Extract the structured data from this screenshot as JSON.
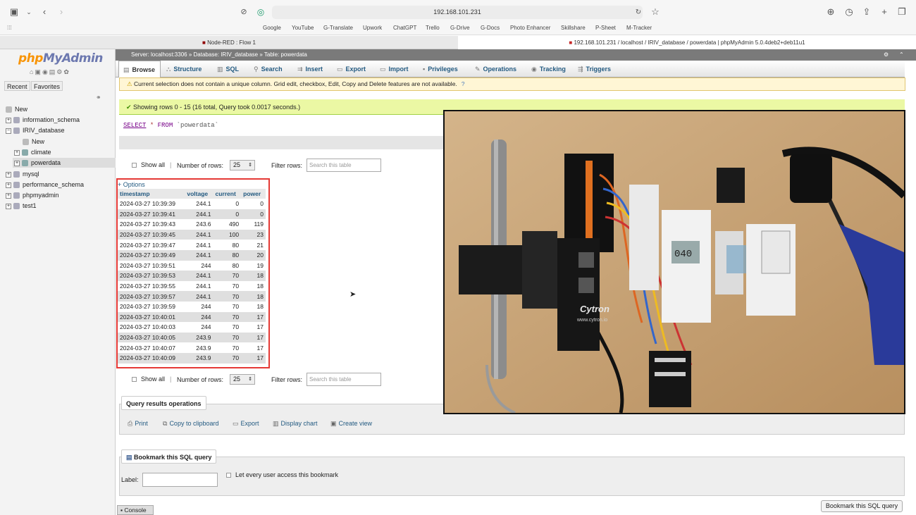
{
  "browser": {
    "url": "192.168.101.231",
    "bookmarks": [
      "Google",
      "YouTube",
      "G-Translate",
      "Upwork",
      "ChatGPT",
      "Trello",
      "G-Drive",
      "G-Docs",
      "Photo Enhancer",
      "Skillshare",
      "P-Sheet",
      "M-Tracker"
    ],
    "tabs": [
      {
        "label": "Node-RED : Flow 1",
        "active": false
      },
      {
        "label": "192.168.101.231 / localhost / IRIV_database / powerdata | phpMyAdmin 5.0.4deb2+deb11u1",
        "active": true
      }
    ]
  },
  "sidebar": {
    "logo_php": "php",
    "logo_rest": "MyAdmin",
    "tab_recent": "Recent",
    "tab_favorites": "Favorites",
    "tree": [
      {
        "label": "New",
        "indent": 0,
        "type": "new"
      },
      {
        "label": "information_schema",
        "indent": 0,
        "type": "db"
      },
      {
        "label": "IRIV_database",
        "indent": 0,
        "type": "db"
      },
      {
        "label": "New",
        "indent": 1,
        "type": "new"
      },
      {
        "label": "climate",
        "indent": 1,
        "type": "table"
      },
      {
        "label": "powerdata",
        "indent": 1,
        "type": "table",
        "selected": true
      },
      {
        "label": "mysql",
        "indent": 0,
        "type": "db"
      },
      {
        "label": "performance_schema",
        "indent": 0,
        "type": "db"
      },
      {
        "label": "phpmyadmin",
        "indent": 0,
        "type": "db"
      },
      {
        "label": "test1",
        "indent": 0,
        "type": "db"
      }
    ]
  },
  "breadcrumb": {
    "server": "Server: localhost:3306",
    "database": "Database: IRIV_database",
    "table": "Table: powerdata"
  },
  "menu": [
    {
      "label": "Browse",
      "icon": "▤",
      "active": true
    },
    {
      "label": "Structure",
      "icon": "⛬"
    },
    {
      "label": "SQL",
      "icon": "▥"
    },
    {
      "label": "Search",
      "icon": "⚲"
    },
    {
      "label": "Insert",
      "icon": "⇉"
    },
    {
      "label": "Export",
      "icon": "▭"
    },
    {
      "label": "Import",
      "icon": "▭"
    },
    {
      "label": "Privileges",
      "icon": "▪"
    },
    {
      "label": "Operations",
      "icon": "✎"
    },
    {
      "label": "Tracking",
      "icon": "◉"
    },
    {
      "label": "Triggers",
      "icon": "⇶"
    }
  ],
  "warning": "Current selection does not contain a unique column. Grid edit, checkbox, Edit, Copy and Delete features are not available.",
  "success": "Showing rows 0 - 15 (16 total, Query took 0.0017 seconds.)",
  "sql": {
    "select": "SELECT",
    "star": "*",
    "from": "FROM",
    "table": "`powerdata`"
  },
  "controls": {
    "show_all": "Show all",
    "num_rows_label": "Number of rows:",
    "num_rows_value": "25",
    "filter_label": "Filter rows:",
    "filter_placeholder": "Search this table"
  },
  "options_link": "+ Options",
  "table": {
    "columns": [
      "timestamp",
      "voltage",
      "current",
      "power"
    ],
    "rows": [
      [
        "2024-03-27 10:39:39",
        "244.1",
        "0",
        "0"
      ],
      [
        "2024-03-27 10:39:41",
        "244.1",
        "0",
        "0"
      ],
      [
        "2024-03-27 10:39:43",
        "243.6",
        "490",
        "119"
      ],
      [
        "2024-03-27 10:39:45",
        "244.1",
        "100",
        "23"
      ],
      [
        "2024-03-27 10:39:47",
        "244.1",
        "80",
        "21"
      ],
      [
        "2024-03-27 10:39:49",
        "244.1",
        "80",
        "20"
      ],
      [
        "2024-03-27 10:39:51",
        "244",
        "80",
        "19"
      ],
      [
        "2024-03-27 10:39:53",
        "244.1",
        "70",
        "18"
      ],
      [
        "2024-03-27 10:39:55",
        "244.1",
        "70",
        "18"
      ],
      [
        "2024-03-27 10:39:57",
        "244.1",
        "70",
        "18"
      ],
      [
        "2024-03-27 10:39:59",
        "244",
        "70",
        "18"
      ],
      [
        "2024-03-27 10:40:01",
        "244",
        "70",
        "17"
      ],
      [
        "2024-03-27 10:40:03",
        "244",
        "70",
        "17"
      ],
      [
        "2024-03-27 10:40:05",
        "243.9",
        "70",
        "17"
      ],
      [
        "2024-03-27 10:40:07",
        "243.9",
        "70",
        "17"
      ],
      [
        "2024-03-27 10:40:09",
        "243.9",
        "70",
        "17"
      ]
    ]
  },
  "query_ops": {
    "legend": "Query results operations",
    "items": [
      {
        "label": "Print",
        "icon": "⎙"
      },
      {
        "label": "Copy to clipboard",
        "icon": "⧉"
      },
      {
        "label": "Export",
        "icon": "▭"
      },
      {
        "label": "Display chart",
        "icon": "▥"
      },
      {
        "label": "Create view",
        "icon": "▣"
      }
    ]
  },
  "bookmark": {
    "legend": "Bookmark this SQL query",
    "label": "Label:",
    "share": "Let every user access this bookmark",
    "button": "Bookmark this SQL query"
  },
  "console": "Console",
  "photo_labels": {
    "brand": "Cytron",
    "url": "www.cytron.io",
    "meter": "040"
  }
}
